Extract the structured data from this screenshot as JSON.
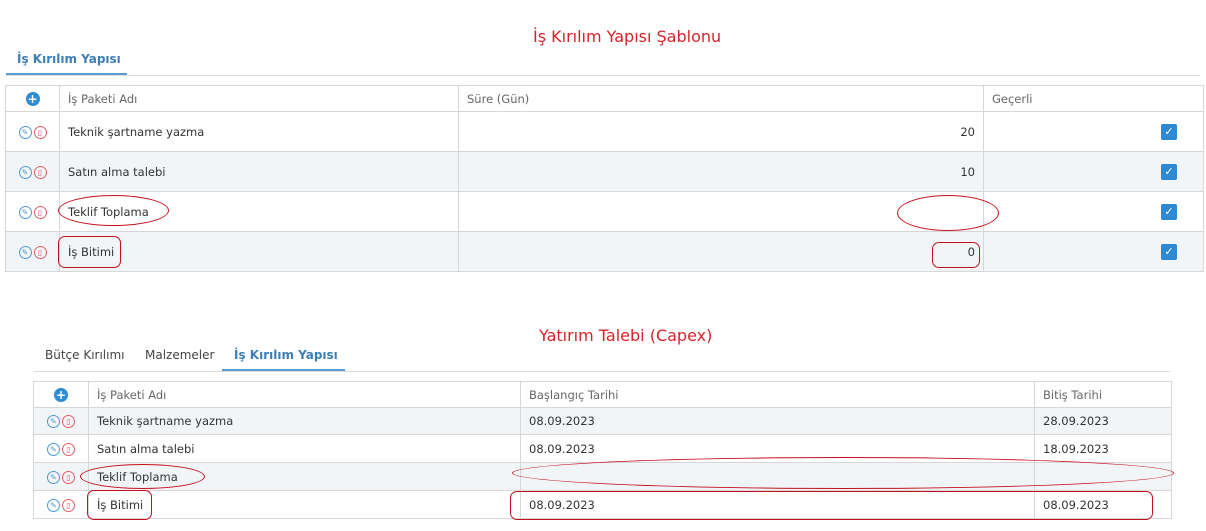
{
  "section1": {
    "title": "İş Kırılım Yapısı Şablonu",
    "tab": "İş Kırılım Yapısı",
    "headers": [
      "İş Paketi Adı",
      "Süre (Gün)",
      "Geçerli"
    ],
    "rows": [
      {
        "name": "Teknik şartname yazma",
        "duration": "20",
        "valid": true
      },
      {
        "name": "Satın alma talebi",
        "duration": "10",
        "valid": true
      },
      {
        "name": "Teklif Toplama",
        "duration": "",
        "valid": true
      },
      {
        "name": "İş Bitimi",
        "duration": "0",
        "valid": true
      }
    ]
  },
  "section2": {
    "title": "Yatırım Talebi (Capex)",
    "tabs": [
      "Bütçe Kırılımı",
      "Malzemeler",
      "İş Kırılım Yapısı"
    ],
    "active_tab": "İş Kırılım Yapısı",
    "headers": [
      "İş Paketi Adı",
      "Başlangıç Tarihi",
      "Bitiş Tarihi"
    ],
    "rows": [
      {
        "name": "Teknik şartname yazma",
        "start": "08.09.2023",
        "end": "28.09.2023"
      },
      {
        "name": "Satın alma talebi",
        "start": "08.09.2023",
        "end": "18.09.2023"
      },
      {
        "name": "Teklif Toplama",
        "start": "",
        "end": ""
      },
      {
        "name": "İş Bitimi",
        "start": "08.09.2023",
        "end": "08.09.2023"
      }
    ]
  },
  "colors": {
    "accent": "#2d8ad2",
    "annotation": "#c4101d",
    "title": "#d8232a"
  },
  "icons": {
    "add": "plus-circle-icon",
    "edit": "pencil-icon",
    "delete": "trash-icon",
    "check": "checkmark-icon"
  }
}
